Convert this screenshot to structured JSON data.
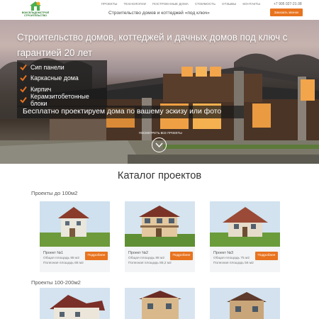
{
  "header": {
    "logo_text": "ВОКСЕЛЬДОМСТРОЙ СТРОИТЕЛЬСТВО",
    "nav": [
      "ПРОЕКТЫ",
      "ТЕХНОЛОГИИ",
      "ПОСТРОЕННЫЕ ДОМА",
      "СТОИМОСТЬ",
      "ОТЗЫВЫ",
      "КОНТАКТЫ"
    ],
    "tagline": "Строительство домов и коттеджей «под ключ»",
    "phone": "+7 905 027-21-38",
    "callback_label": "Заказать звонок"
  },
  "hero": {
    "title": "Строительство домов, коттеджей и дачных домов под ключ с гарантией 20 лет",
    "features": [
      "Сип панели",
      "Каркасные дома",
      "Кирпич",
      "Керамзитобетонные блоки"
    ],
    "design_banner": "Бесплатно проектируем дома по вашему эскизу или фото",
    "scroll_label": "ПОСМОТРЕТЬ ВСЕ ПРОЕКТЫ"
  },
  "catalog": {
    "title": "Каталог проектов",
    "section1_heading": "Проекты до 100м2",
    "section2_heading": "Проекты 100-200м2",
    "cards": [
      {
        "name": "Проект №1",
        "total": "Общая площадь 88 м2",
        "useful": "Полезная площадь 88 м2",
        "button": "Подробнее"
      },
      {
        "name": "Проект №2",
        "total": "Общая площадь 88 м2",
        "useful": "Полезная площадь 88,2 м2",
        "button": "Подробнее"
      },
      {
        "name": "Проект №3",
        "total": "Общая площадь 75 м2",
        "useful": "Полезная площадь 56 м2",
        "button": "Подробнее"
      }
    ]
  },
  "colors": {
    "accent": "#e8731f",
    "brand_green": "#2e7d32",
    "overlay": "#191919"
  },
  "icons": {
    "feature": "check-icon",
    "scroll": "chevron-down-icon",
    "logo": "house-logo-icon"
  }
}
